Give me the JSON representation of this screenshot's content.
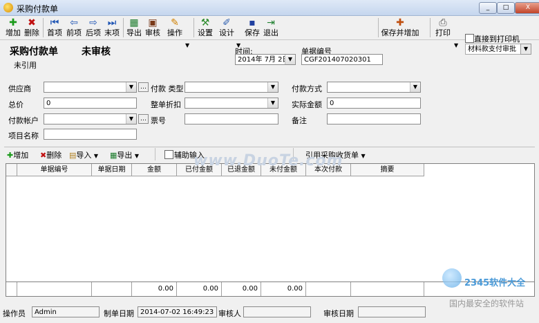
{
  "window": {
    "title": "采购付款单",
    "min_label": "_",
    "max_label": "□",
    "close_label": "X"
  },
  "toolbar": {
    "add": "增加",
    "delete": "删除",
    "first": "首项",
    "prev": "前项",
    "next": "后项",
    "last": "末项",
    "export": "导出",
    "audit": "审核",
    "operate": "操作",
    "settings": "设置",
    "design": "设计",
    "save": "保存",
    "exit": "退出",
    "save_add": "保存并增加",
    "print": "打印",
    "print_direct": "直接到打印机",
    "print_template": "材料款支付审批"
  },
  "header": {
    "doc_title": "采购付款单",
    "status": "未审核",
    "ref_status": "未引用",
    "time_label": "时间:",
    "date_value": "2014年 7月 2日",
    "doc_no_label": "单据编号",
    "doc_no_value": "CGF201407020301"
  },
  "form": {
    "supplier_label": "供应商",
    "supplier_value": "",
    "pay_type_label": "付款 类型",
    "pay_type_value": "",
    "pay_method_label": "付款方式",
    "pay_method_value": "",
    "total_label": "总价",
    "total_value": "0",
    "discount_label": "整单折扣",
    "discount_value": "",
    "actual_label": "实际金额",
    "actual_value": "0",
    "account_label": "付款帐户",
    "account_value": "",
    "ticket_label": "票号",
    "ticket_value": "",
    "remark_label": "备注",
    "remark_value": "",
    "project_label": "项目名称",
    "project_value": ""
  },
  "gridbar": {
    "add": "增加",
    "delete": "删除",
    "import": "导入",
    "export": "导出",
    "assist": "辅助输入",
    "ref": "引用采购收货单"
  },
  "grid": {
    "columns": [
      "单据编号",
      "单据日期",
      "金额",
      "已付金额",
      "已退金额",
      "未付金额",
      "本次付款",
      "摘要"
    ],
    "totals": [
      "0.00",
      "0.00",
      "0.00",
      "0.00"
    ]
  },
  "footer": {
    "operator_label": "操作员",
    "operator_value": "Admin",
    "created_label": "制单日期",
    "created_value": "2014-07-02 16:49:23",
    "auditor_label": "审核人",
    "auditor_value": "",
    "audit_date_label": "审核日期",
    "audit_date_value": ""
  },
  "watermark": {
    "text1": "www.DuoTe.com",
    "text2": "2345软件大全",
    "text3": "国内最安全的软件站"
  }
}
